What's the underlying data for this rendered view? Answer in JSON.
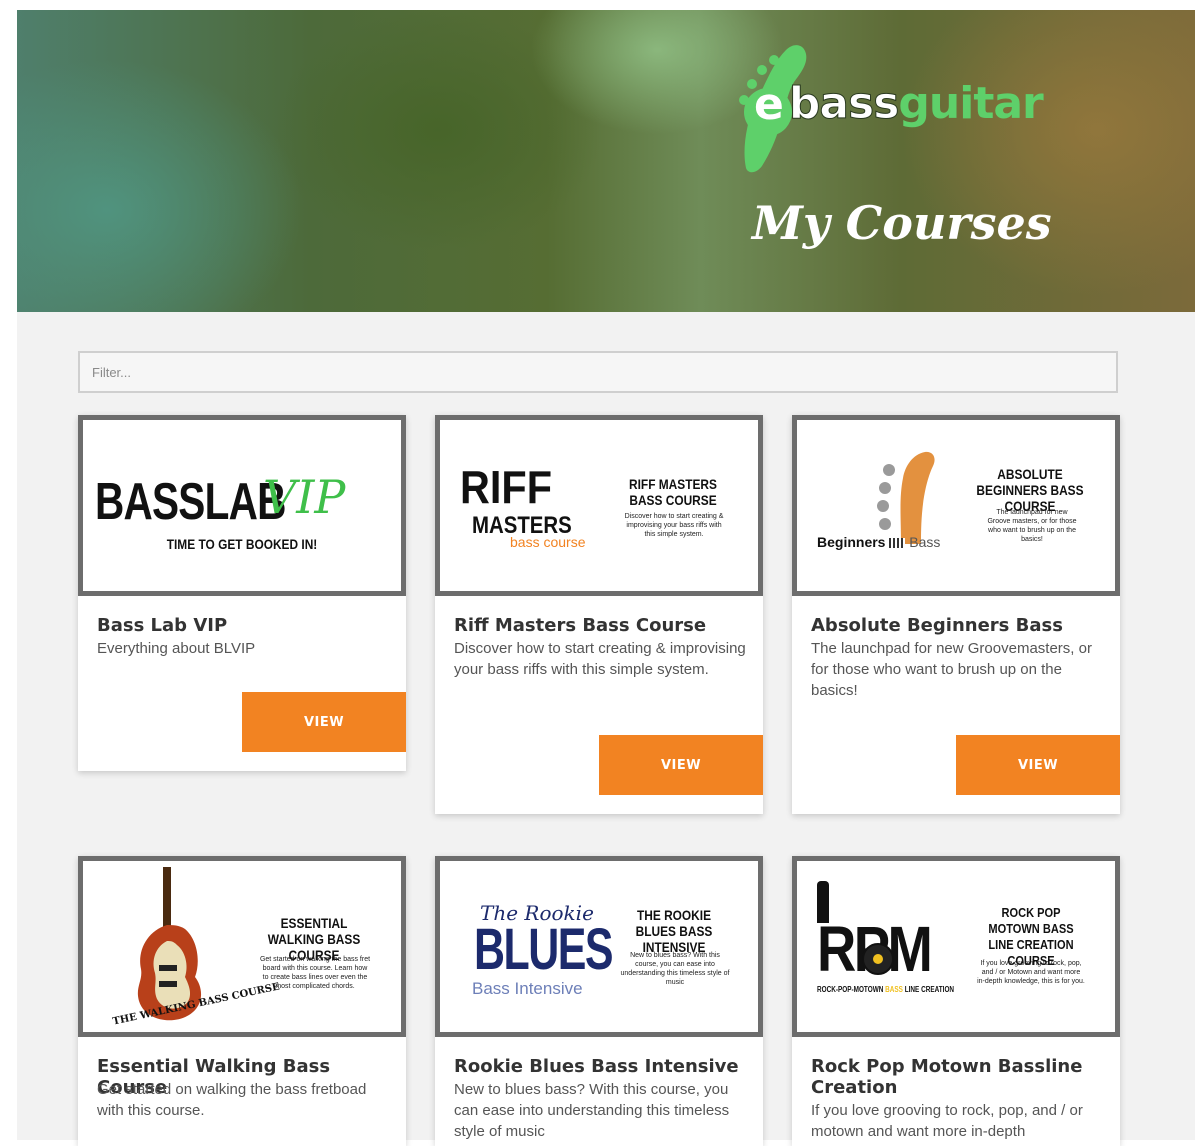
{
  "brand": {
    "logo_part1": "bass",
    "logo_part2": "guitar",
    "logo_e": "e"
  },
  "hero": {
    "title": "My Courses"
  },
  "filter": {
    "placeholder": "Filter..."
  },
  "colors": {
    "accent": "#f28322",
    "frame": "#6d6d6d",
    "logo_green": "#5ed06a"
  },
  "courses": [
    {
      "title": "Bass Lab VIP",
      "description": "Everything about BLVIP",
      "button": "VIEW",
      "thumb": {
        "logo_main": "BASSLAB",
        "logo_accent": "VIP",
        "tagline": "TIME TO GET BOOKED IN!"
      }
    },
    {
      "title": "Riff Masters Bass Course",
      "description": "Discover how to start creating & improvising your bass riffs with this simple system.",
      "button": "VIEW",
      "thumb": {
        "logo_line1": "RIFF",
        "logo_line2": "MASTERS",
        "logo_line3": "bass course",
        "heading": "RIFF MASTERS BASS COURSE",
        "body": "Discover how to start creating & improvising your bass riffs with this simple system."
      }
    },
    {
      "title": "Absolute Beginners Bass",
      "description": "The launchpad for new Groovemasters, or for those who want to brush up on the basics!",
      "button": "VIEW",
      "thumb": {
        "logo_word1": "Beginners",
        "logo_word2": "Bass",
        "heading": "ABSOLUTE BEGINNERS BASS COURSE",
        "body": "The launchpad for new Groove masters, or for those who want to brush up on the basics!"
      }
    },
    {
      "title": "Essential Walking Bass Course",
      "description": "Get started on walking the bass fretboad with this course.",
      "thumb": {
        "arc_text": "THE WALKING BASS COURSE",
        "heading": "ESSENTIAL WALKING BASS COURSE",
        "body": "Get started on walking the bass fret board with this course. Learn how to create bass lines over even the most complicated chords."
      }
    },
    {
      "title": "Rookie Blues Bass Intensive",
      "description": "New to blues bass? With this course, you can ease into understanding this timeless style of music",
      "thumb": {
        "logo_script": "The Rookie",
        "logo_main": "BLUES",
        "logo_sub": "Bass Intensive",
        "heading": "THE ROOKIE BLUES BASS INTENSIVE",
        "body": "New to blues bass? With this course, you can ease into understanding this timeless style of music"
      }
    },
    {
      "title": "Rock Pop Motown Bassline Creation",
      "description": "If you love grooving to rock, pop, and / or motown and want more in-depth",
      "thumb": {
        "logo_main": "RPM",
        "logo_sub_a": "ROCK-POP-MOTOWN",
        "logo_sub_b": "BASS",
        "logo_sub_c": "LINE CREATION",
        "heading": "ROCK POP MOTOWN BASS LINE CREATION COURSE",
        "body": "If you love grooving to rock, pop, and / or Motown and want more in-depth knowledge, this is for you."
      }
    }
  ]
}
